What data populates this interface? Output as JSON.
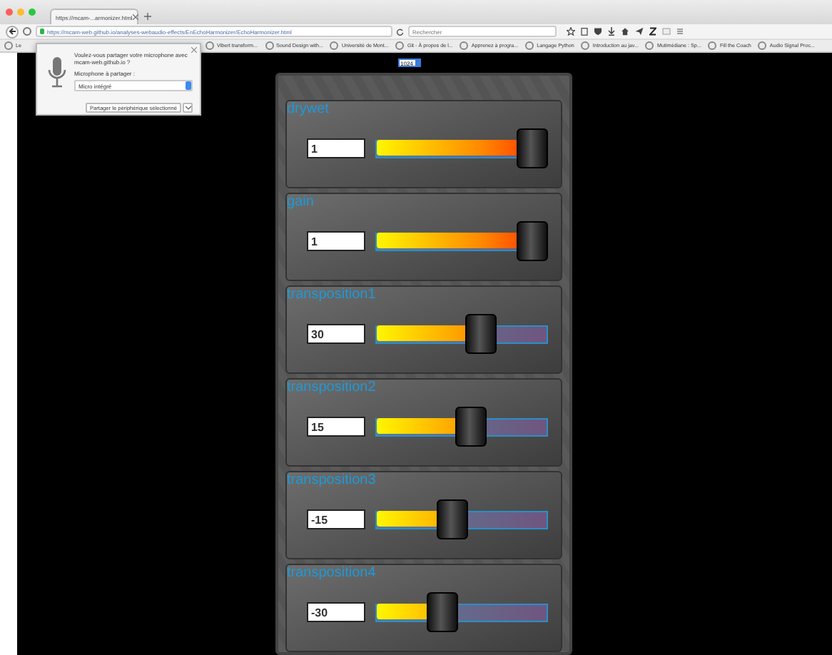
{
  "browser": {
    "tab_title": "https://mcam-...armonizer.html",
    "url": "https://mcam-web.github.io/analyses-webaudio-effects/EnEchoHarmonizer/EchoHarmonizer.html",
    "search_placeholder": "Rechercher",
    "bookmarks": [
      "Le",
      "Vibert transform...",
      "Sound Design with...",
      "Université de Mont...",
      "Git - À propos de l...",
      "Apprenez à progra...",
      "Langage Python",
      "Introduction au jav...",
      "Mutimédiane : Sp...",
      "Fill the Coach",
      "Audio Signal Proc..."
    ]
  },
  "permission_popup": {
    "message": "Voulez-vous partager votre microphone avec mcam-web.github.io ?",
    "label": "Microphone à partager :",
    "device": "Micro intégré",
    "share_button": "Partager le périphérique sélectionné"
  },
  "buffer_size": "1024",
  "controls": [
    {
      "label": "drywet",
      "value": "1",
      "level": 1
    },
    {
      "label": "gain",
      "value": "1",
      "level": 1
    },
    {
      "label": "transposition1",
      "value": "30",
      "level": 0.64
    },
    {
      "label": "transposition2",
      "value": "15",
      "level": 0.57
    },
    {
      "label": "transposition3",
      "value": "-15",
      "level": 0.43
    },
    {
      "label": "transposition4",
      "value": "-30",
      "level": 0.36
    }
  ]
}
